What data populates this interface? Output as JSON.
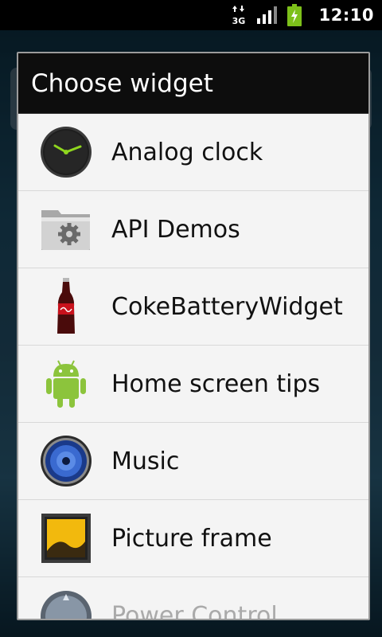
{
  "status_bar": {
    "network": "3G",
    "time": "12:10",
    "icons": [
      "data-3g-icon",
      "signal-strength-icon",
      "battery-charging-icon"
    ]
  },
  "dialog": {
    "title": "Choose widget",
    "items": [
      {
        "label": "Analog clock",
        "icon": "analog-clock-icon"
      },
      {
        "label": "API Demos",
        "icon": "folder-gear-icon"
      },
      {
        "label": "CokeBatteryWidget",
        "icon": "coke-bottle-icon"
      },
      {
        "label": "Home screen tips",
        "icon": "android-robot-icon"
      },
      {
        "label": "Music",
        "icon": "speaker-icon"
      },
      {
        "label": "Picture frame",
        "icon": "picture-frame-icon"
      },
      {
        "label": "Power Control",
        "icon": "power-control-icon"
      }
    ]
  },
  "colors": {
    "title_bar": "#0d0d0d",
    "list_background": "#f4f4f4",
    "divider": "#d8d8d8",
    "status_bar": "#000000",
    "battery": "#7dc01a"
  }
}
